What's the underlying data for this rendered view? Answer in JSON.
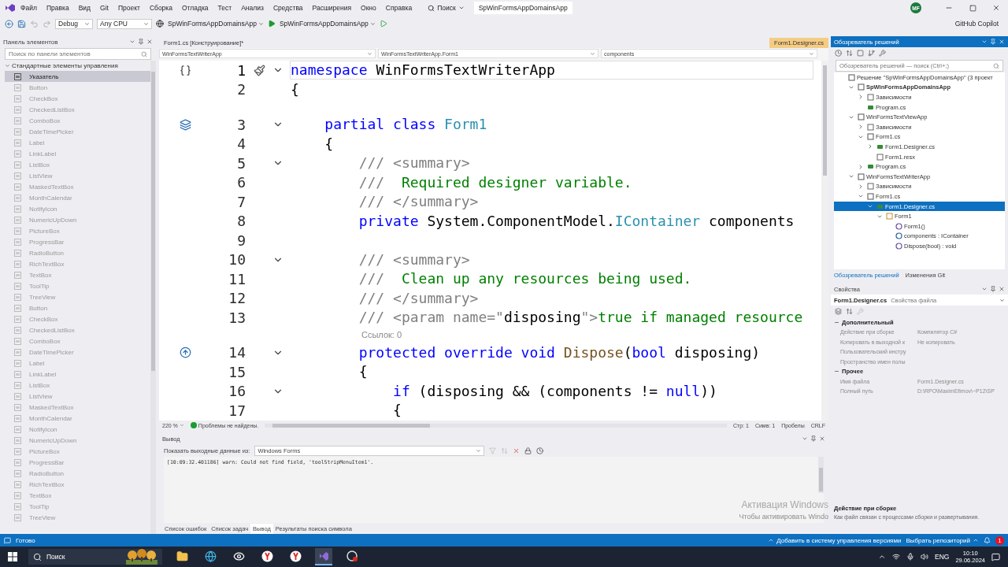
{
  "menu_bar": {
    "items": [
      "Файл",
      "Правка",
      "Вид",
      "Git",
      "Проект",
      "Сборка",
      "Отладка",
      "Тест",
      "Анализ",
      "Средства",
      "Расширения",
      "Окно",
      "Справка"
    ],
    "search": "Поиск",
    "solution_title": "SpWinFormsAppDomainsApp",
    "account": "MF"
  },
  "toolbar": {
    "configuration": "Debug",
    "platform": "Any CPU",
    "startup_project": "SpWinFormsAppDomainsApp",
    "run_target": "SpWinFormsAppDomainsApp",
    "copilot": "GitHub Copilot"
  },
  "toolbox": {
    "title": "Панель элементов",
    "search": {
      "placeholder": "Поиск по панели элементов"
    },
    "group": {
      "label": "Стандартные элементы управления",
      "expanded": true
    },
    "items": [
      {
        "label": "Указатель",
        "selected": true,
        "disabled": false
      },
      {
        "label": "Button",
        "selected": false,
        "disabled": true
      },
      {
        "label": "CheckBox",
        "selected": false,
        "disabled": true
      },
      {
        "label": "CheckedListBox",
        "selected": false,
        "disabled": true
      },
      {
        "label": "ComboBox",
        "selected": false,
        "disabled": true
      },
      {
        "label": "DateTimePicker",
        "selected": false,
        "disabled": true
      },
      {
        "label": "Label",
        "selected": false,
        "disabled": true
      },
      {
        "label": "LinkLabel",
        "selected": false,
        "disabled": true
      },
      {
        "label": "ListBox",
        "selected": false,
        "disabled": true
      },
      {
        "label": "ListView",
        "selected": false,
        "disabled": true
      },
      {
        "label": "MaskedTextBox",
        "selected": false,
        "disabled": true
      },
      {
        "label": "MonthCalendar",
        "selected": false,
        "disabled": true
      },
      {
        "label": "NotifyIcon",
        "selected": false,
        "disabled": true
      },
      {
        "label": "NumericUpDown",
        "selected": false,
        "disabled": true
      },
      {
        "label": "PictureBox",
        "selected": false,
        "disabled": true
      },
      {
        "label": "ProgressBar",
        "selected": false,
        "disabled": true
      },
      {
        "label": "RadioButton",
        "selected": false,
        "disabled": true
      },
      {
        "label": "RichTextBox",
        "selected": false,
        "disabled": true
      },
      {
        "label": "TextBox",
        "selected": false,
        "disabled": true
      },
      {
        "label": "ToolTip",
        "selected": false,
        "disabled": true
      },
      {
        "label": "TreeView",
        "selected": false,
        "disabled": true
      },
      {
        "label": "Button",
        "selected": false,
        "disabled": true
      },
      {
        "label": "CheckBox",
        "selected": false,
        "disabled": true
      },
      {
        "label": "CheckedListBox",
        "selected": false,
        "disabled": true
      },
      {
        "label": "ComboBox",
        "selected": false,
        "disabled": true
      },
      {
        "label": "DateTimePicker",
        "selected": false,
        "disabled": true
      },
      {
        "label": "Label",
        "selected": false,
        "disabled": true
      },
      {
        "label": "LinkLabel",
        "selected": false,
        "disabled": true
      },
      {
        "label": "ListBox",
        "selected": false,
        "disabled": true
      },
      {
        "label": "ListView",
        "selected": false,
        "disabled": true
      },
      {
        "label": "MaskedTextBox",
        "selected": false,
        "disabled": true
      },
      {
        "label": "MonthCalendar",
        "selected": false,
        "disabled": true
      },
      {
        "label": "NotifyIcon",
        "selected": false,
        "disabled": true
      },
      {
        "label": "NumericUpDown",
        "selected": false,
        "disabled": true
      },
      {
        "label": "PictureBox",
        "selected": false,
        "disabled": true
      },
      {
        "label": "ProgressBar",
        "selected": false,
        "disabled": true
      },
      {
        "label": "RadioButton",
        "selected": false,
        "disabled": true
      },
      {
        "label": "RichTextBox",
        "selected": false,
        "disabled": true
      },
      {
        "label": "TextBox",
        "selected": false,
        "disabled": true
      },
      {
        "label": "ToolTip",
        "selected": false,
        "disabled": true
      },
      {
        "label": "TreeView",
        "selected": false,
        "disabled": true
      }
    ]
  },
  "editor": {
    "tabs": [
      {
        "label": "Form1.cs [Конструирование]*",
        "selected": false
      },
      {
        "label": "Form1.Designer.cs",
        "selected": true
      }
    ],
    "nav": [
      "WinFormsTextWriterApp",
      "WinFormsTextWriterApp.Form1",
      "components"
    ],
    "lines": [
      {
        "number": "1",
        "fold": true,
        "current": true,
        "margin_icon": {
          "kind": "namespace"
        },
        "tokens": [
          {
            "text": "namespace",
            "kind": "keyword"
          },
          {
            "text": " WinFormsTextWriterApp",
            "kind": "plain"
          }
        ]
      },
      {
        "number": "2",
        "fold": false,
        "current": false,
        "tokens": [
          {
            "text": "{",
            "kind": "plain"
          }
        ]
      },
      {
        "number": "3",
        "fold": true,
        "current": false,
        "gap_above": true,
        "margin_icon": {
          "kind": "class"
        },
        "tokens": [
          {
            "text": "    partial class",
            "kind": "keyword"
          },
          {
            "text": " Form1",
            "kind": "type"
          }
        ]
      },
      {
        "number": "4",
        "fold": false,
        "current": false,
        "tokens": [
          {
            "text": "    {",
            "kind": "plain"
          }
        ]
      },
      {
        "number": "5",
        "fold": true,
        "current": false,
        "tokens": [
          {
            "text": "        /// <summary>",
            "kind": "doc"
          }
        ]
      },
      {
        "number": "6",
        "fold": false,
        "current": false,
        "tokens": [
          {
            "text": "        ///",
            "kind": "doc"
          },
          {
            "text": "  Required designer variable.",
            "kind": "comment"
          }
        ]
      },
      {
        "number": "7",
        "fold": false,
        "current": false,
        "tokens": [
          {
            "text": "        /// </summary>",
            "kind": "doc"
          }
        ]
      },
      {
        "number": "8",
        "fold": false,
        "current": false,
        "tokens": [
          {
            "text": "        private",
            "kind": "keyword"
          },
          {
            "text": " System.ComponentModel.",
            "kind": "plain"
          },
          {
            "text": "IContainer",
            "kind": "type"
          },
          {
            "text": " components",
            "kind": "plain"
          }
        ]
      },
      {
        "number": "9",
        "fold": false,
        "current": false
      },
      {
        "number": "10",
        "fold": true,
        "current": false,
        "tokens": [
          {
            "text": "        /// <summary>",
            "kind": "doc"
          }
        ]
      },
      {
        "number": "11",
        "fold": false,
        "current": false,
        "tokens": [
          {
            "text": "        ///",
            "kind": "doc"
          },
          {
            "text": "  Clean up any resources being used.",
            "kind": "comment"
          }
        ]
      },
      {
        "number": "12",
        "fold": false,
        "current": false,
        "tokens": [
          {
            "text": "        /// </summary>",
            "kind": "doc"
          }
        ]
      },
      {
        "number": "13",
        "fold": false,
        "current": false,
        "tokens": [
          {
            "text": "        /// <param name=\"",
            "kind": "doc"
          },
          {
            "text": "disposing",
            "kind": "plain"
          },
          {
            "text": "\">",
            "kind": "doc"
          },
          {
            "text": "true if managed resource",
            "kind": "comment"
          }
        ]
      },
      {
        "number": "14",
        "fold": true,
        "current": false,
        "gap_above": true,
        "lens": "Ссылок: 0",
        "margin_icon": {
          "kind": "override"
        },
        "tokens": [
          {
            "text": "        protected override void",
            "kind": "keyword"
          },
          {
            "text": " Dispose",
            "kind": "method"
          },
          {
            "text": "(",
            "kind": "plain"
          },
          {
            "text": "bool",
            "kind": "keyword"
          },
          {
            "text": " disposing)",
            "kind": "plain"
          }
        ]
      },
      {
        "number": "15",
        "fold": false,
        "current": false,
        "tokens": [
          {
            "text": "        {",
            "kind": "plain"
          }
        ]
      },
      {
        "number": "16",
        "fold": true,
        "current": false,
        "tokens": [
          {
            "text": "            if",
            "kind": "keyword"
          },
          {
            "text": " (disposing && (components != ",
            "kind": "plain"
          },
          {
            "text": "null",
            "kind": "keyword"
          },
          {
            "text": "))",
            "kind": "plain"
          }
        ]
      },
      {
        "number": "17",
        "fold": false,
        "current": false,
        "tokens": [
          {
            "text": "            {",
            "kind": "plain"
          }
        ]
      }
    ],
    "status": {
      "zoom": "220 %",
      "problems": "Проблемы не найдены.",
      "line": "Стр: 1",
      "col": "Симв: 1",
      "indent": "Пробелы",
      "eol": "CRLF"
    }
  },
  "output": {
    "title": "Вывод",
    "source_label": "Показать выходные данные из:",
    "source": "Windows Forms",
    "log": "[10:09:32.401186] warn: Could not find field, 'toolStripMenuItem1'."
  },
  "bottom_tabs": [
    {
      "label": "Список ошибок",
      "selected": false
    },
    {
      "label": "Список задач",
      "selected": false
    },
    {
      "label": "Вывод",
      "selected": true
    },
    {
      "label": "Результаты поиска символа",
      "selected": false
    }
  ],
  "activation": {
    "title": "Активация Windows",
    "text": "Чтобы активировать Windo"
  },
  "solution_explorer": {
    "title": "Обозреватель решений",
    "search": {
      "placeholder": "Обозреватель решений — поиск (Ctrl+;)"
    },
    "tree": [
      {
        "label": "Решение \"SpWinFormsAppDomainsApp\"  (3 проект",
        "kind": "solution",
        "selected": false,
        "children": [
          {
            "label": "SpWinFormsAppDomainsApp",
            "kind": "project",
            "startup": true,
            "expanded": true,
            "selected": false,
            "children": [
              {
                "label": "Зависимости",
                "kind": "deps",
                "expanded": false,
                "selected": false
              },
              {
                "label": "Program.cs",
                "kind": "csharp",
                "selected": false
              }
            ]
          },
          {
            "label": "WinFormsTextViewApp",
            "kind": "project",
            "startup": false,
            "expanded": true,
            "selected": false,
            "children": [
              {
                "label": "Зависимости",
                "kind": "deps",
                "expanded": false,
                "selected": false
              },
              {
                "label": "Form1.cs",
                "kind": "form",
                "expanded": true,
                "selected": false,
                "children": [
                  {
                    "label": "Form1.Designer.cs",
                    "kind": "csharp",
                    "expanded": false,
                    "selected": false
                  },
                  {
                    "label": "Form1.resx",
                    "kind": "resx",
                    "selected": false
                  }
                ]
              },
              {
                "label": "Program.cs",
                "kind": "csharp",
                "expanded": false,
                "selected": false
              }
            ]
          },
          {
            "label": "WinFormsTextWriterApp",
            "kind": "project",
            "startup": false,
            "expanded": true,
            "selected": false,
            "children": [
              {
                "label": "Зависимости",
                "kind": "deps",
                "expanded": false,
                "selected": false
              },
              {
                "label": "Form1.cs",
                "kind": "form",
                "expanded": true,
                "selected": false,
                "children": [
                  {
                    "label": "Form1.Designer.cs",
                    "kind": "csharp",
                    "expanded": true,
                    "selected": true,
                    "children": [
                      {
                        "label": "Form1",
                        "kind": "class",
                        "expanded": true,
                        "selected": false,
                        "children": [
                          {
                            "label": "Form1()",
                            "kind": "method",
                            "selected": false
                          },
                          {
                            "label": "components : IContainer",
                            "kind": "field",
                            "selected": false
                          },
                          {
                            "label": "Dispose(bool) : void",
                            "kind": "method",
                            "selected": false
                          }
                        ]
                      }
                    ]
                  }
                ]
              }
            ]
          }
        ]
      }
    ],
    "tabs": [
      {
        "label": "Обозреватель решений",
        "selected": true
      },
      {
        "label": "Изменения Git",
        "selected": false
      }
    ]
  },
  "properties": {
    "title": "Свойства",
    "object": "Form1.Designer.cs",
    "object_type": "Свойства файла",
    "categories": [
      {
        "name": "Дополнительный",
        "expanded": true,
        "rows": [
          {
            "name": "Действие при сборке",
            "value": "Компилятор C#"
          },
          {
            "name": "Копировать в выходной к",
            "value": "Не копировать"
          },
          {
            "name": "Пользовательский инстру"
          },
          {
            "name": "Пространство имен полы"
          }
        ]
      },
      {
        "name": "Прочее",
        "expanded": true,
        "rows": [
          {
            "name": "Имя файла",
            "value": "Form1.Designer.cs"
          },
          {
            "name": "Полный путь",
            "value": "D:\\RPO\\MaximEfimov\\~P12\\SP"
          }
        ]
      }
    ],
    "description": {
      "title": "Действие при сборке",
      "text": "Как файл связан с процессами сборки и развертывания."
    }
  },
  "status_bar": {
    "text": "Готово",
    "source_control": "Добавить в систему управления версиями",
    "repository": "Выбрать репозиторий",
    "notifications": "1"
  },
  "taskbar": {
    "search": {
      "placeholder": "Поиск"
    },
    "apps": [
      {
        "kind": "folder",
        "active": false
      },
      {
        "kind": "browser",
        "active": false
      },
      {
        "kind": "eye",
        "active": false
      },
      {
        "kind": "yandex",
        "active": false
      },
      {
        "kind": "yandex",
        "active": false
      },
      {
        "kind": "studio",
        "active": true
      },
      {
        "kind": "recorder",
        "active": false
      }
    ],
    "language": "ENG",
    "time": "10:10",
    "date": "29.06.2024"
  }
}
